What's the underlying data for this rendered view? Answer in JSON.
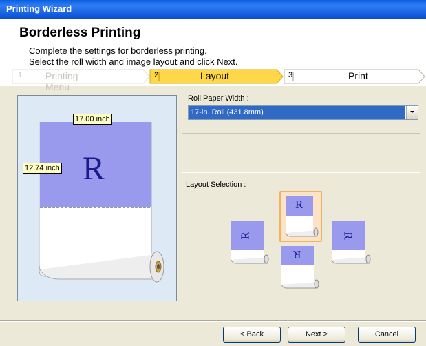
{
  "window": {
    "title": "Printing Wizard"
  },
  "header": {
    "title": "Borderless Printing",
    "line1": "Complete the settings for borderless printing.",
    "line2": "Select the roll width and image layout and click Next."
  },
  "steps": [
    {
      "num": "1",
      "label": "Printing Menu",
      "state": "done"
    },
    {
      "num": "2",
      "label": "Layout",
      "state": "current"
    },
    {
      "num": "3",
      "label": "Print",
      "state": "pending"
    }
  ],
  "preview": {
    "width_label": "17.00 inch",
    "height_label": "12.74 inch",
    "letter": "R"
  },
  "roll_paper": {
    "label": "Roll Paper Width :",
    "selected": "17-in. Roll (431.8mm)"
  },
  "layout": {
    "label": "Layout Selection :",
    "options": [
      "R",
      "R",
      "R",
      "R"
    ]
  },
  "buttons": {
    "back": "< Back",
    "next": "Next >",
    "cancel": "Cancel"
  },
  "colors": {
    "accent": "#f5c000",
    "selection": "#316ac5",
    "paper": "#9999ee"
  }
}
